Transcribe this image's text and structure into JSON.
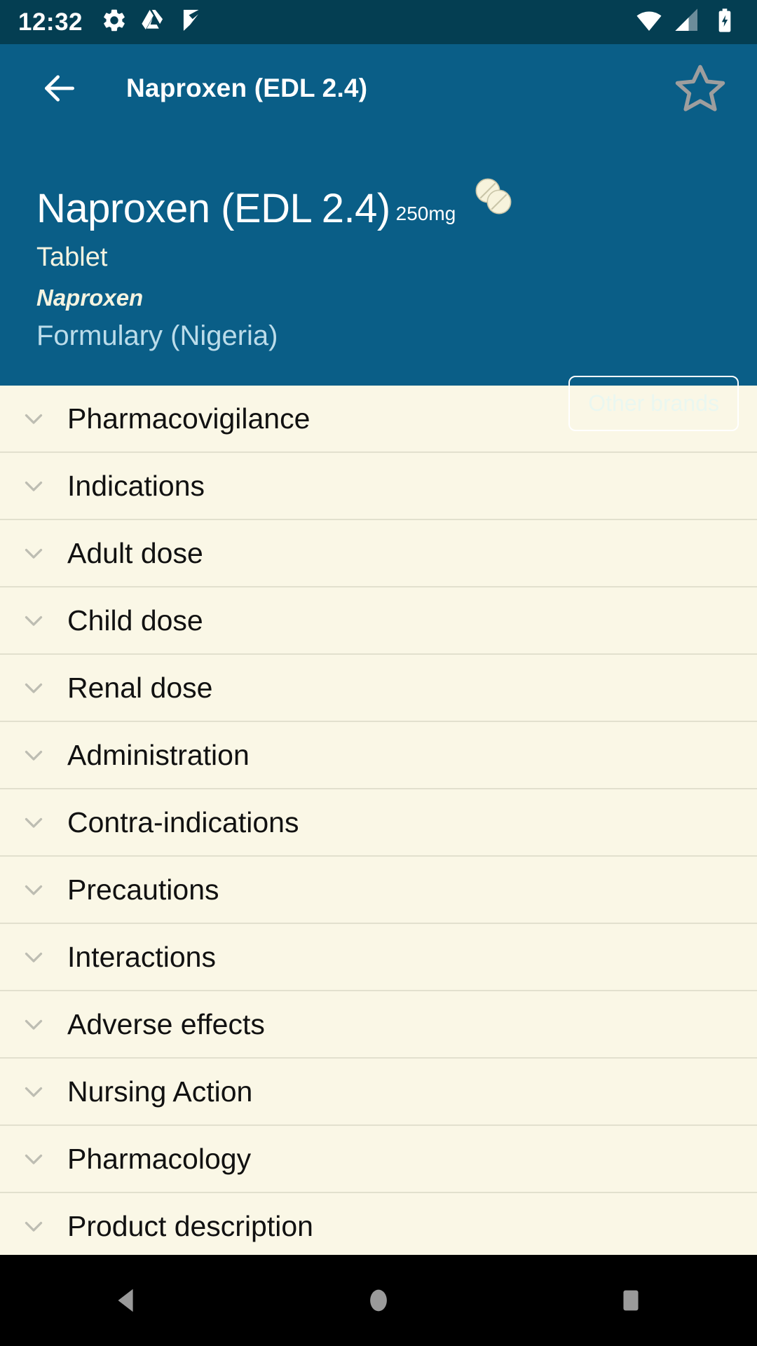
{
  "statusbar": {
    "time": "12:32",
    "left_icons": [
      "gear-icon",
      "drive-icon",
      "checkmark-icon"
    ],
    "right_icons": [
      "wifi-icon",
      "cellular-signal-icon",
      "battery-charging-icon"
    ],
    "background_color": "#043E52"
  },
  "appbar": {
    "back_label": "Back",
    "title": "Naproxen (EDL 2.4)",
    "favorite_label": "Favourite",
    "background_color": "#0A5E87",
    "star_color": "#9E9E9E"
  },
  "hero": {
    "drug_name": "Naproxen (EDL 2.4)",
    "strength": "250mg",
    "form": "Tablet",
    "generic_name": "Naproxen",
    "source": "Formulary (Nigeria)",
    "other_brands_label": "Other brands",
    "pill_icon": "two-tablets-icon",
    "pill_color": "#F7F3DC"
  },
  "sections": {
    "items": [
      {
        "label": "Pharmacovigilance",
        "expanded": false
      },
      {
        "label": "Indications",
        "expanded": false
      },
      {
        "label": "Adult dose",
        "expanded": false
      },
      {
        "label": "Child dose",
        "expanded": false
      },
      {
        "label": "Renal dose",
        "expanded": false
      },
      {
        "label": "Administration",
        "expanded": false
      },
      {
        "label": "Contra-indications",
        "expanded": false
      },
      {
        "label": "Precautions",
        "expanded": false
      },
      {
        "label": "Interactions",
        "expanded": false
      },
      {
        "label": "Adverse effects",
        "expanded": false
      },
      {
        "label": "Nursing Action",
        "expanded": false
      },
      {
        "label": "Pharmacology",
        "expanded": false
      },
      {
        "label": "Product description",
        "expanded": false
      }
    ],
    "background_color": "#FAF7E6",
    "divider_color": "#E2E0CE",
    "chevron_color": "#BDBDB2"
  },
  "navbar": {
    "back_label": "Back",
    "home_label": "Home",
    "recents_label": "Recent apps"
  }
}
